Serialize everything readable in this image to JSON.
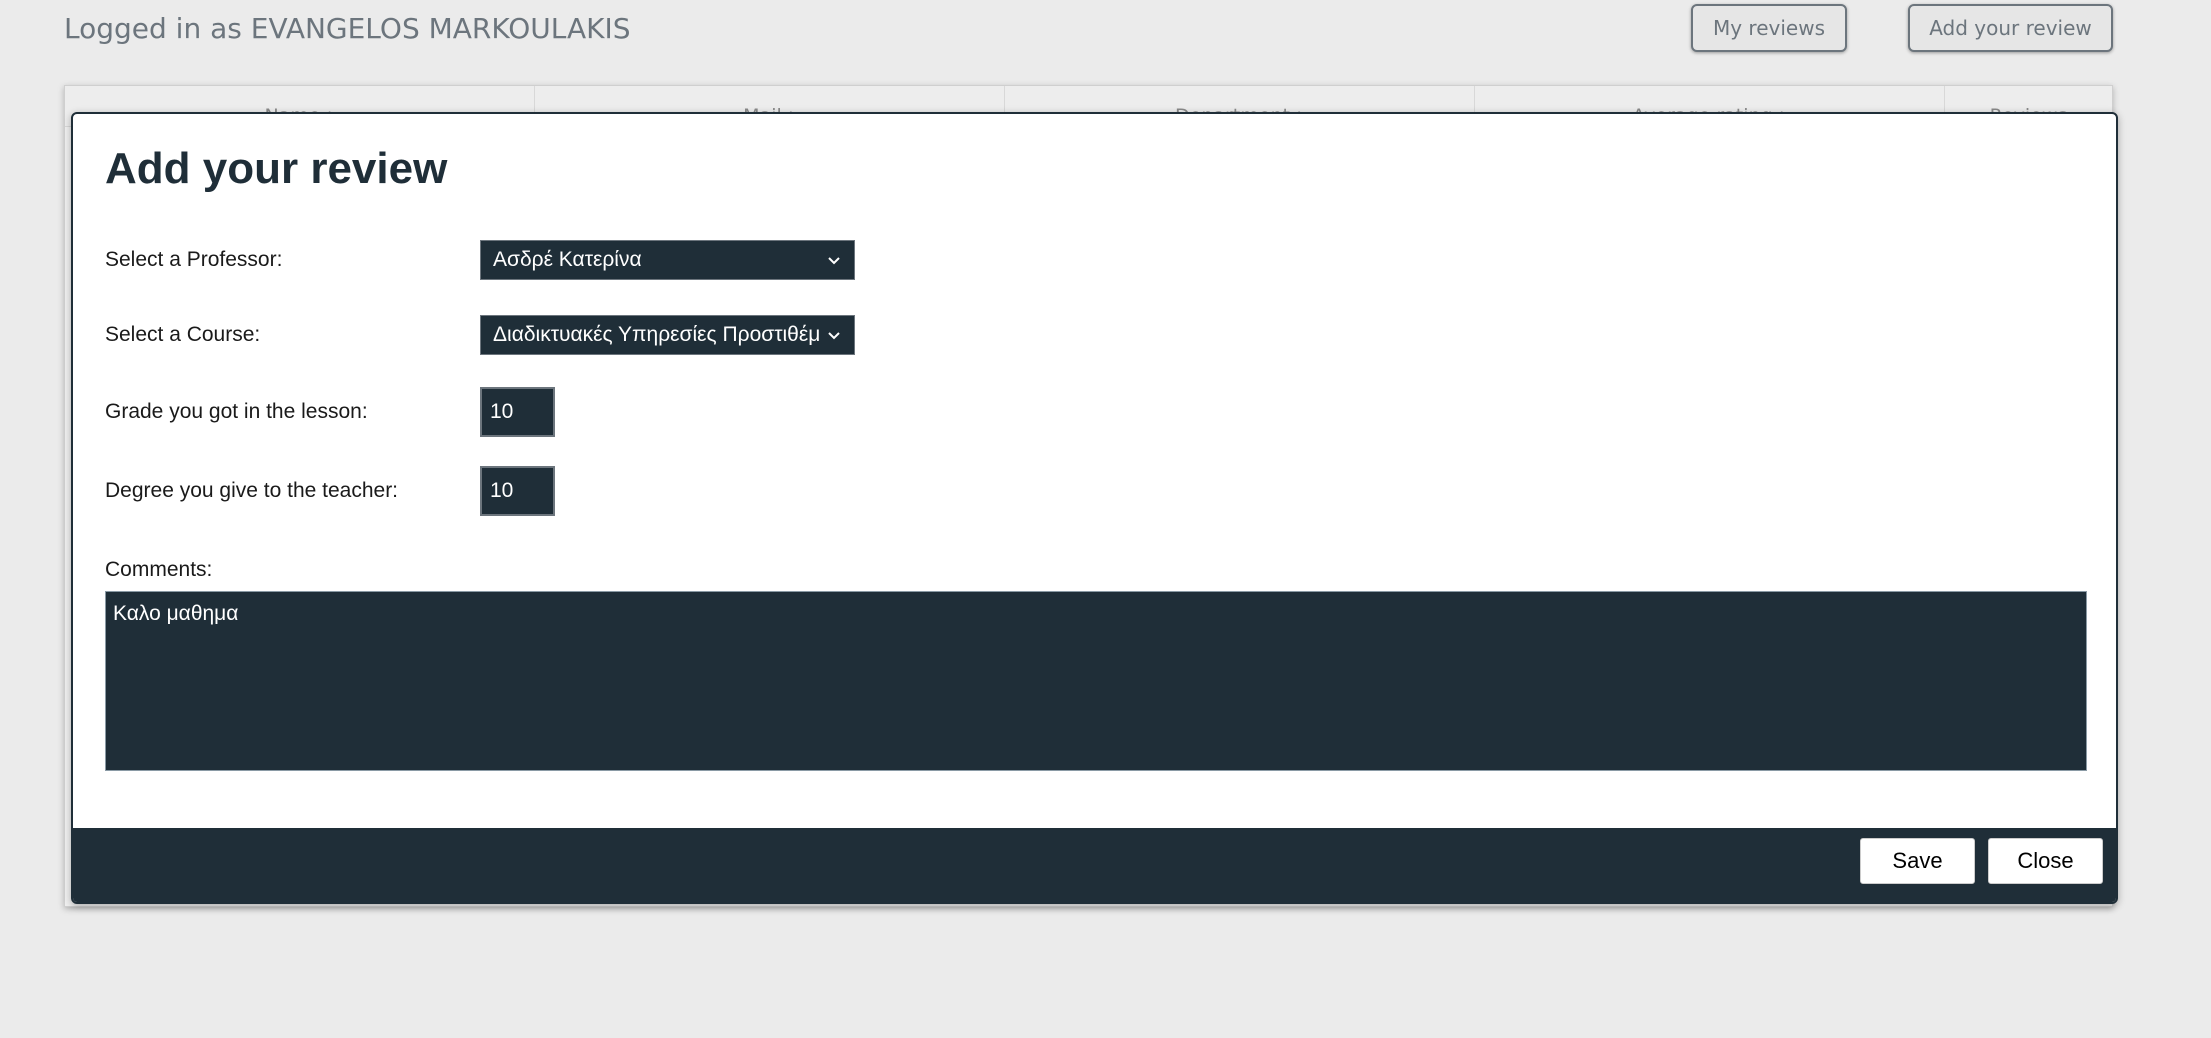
{
  "header": {
    "logged_in_text": "Logged in as EVANGELOS MARKOULAKIS",
    "my_reviews_label": "My reviews",
    "add_review_label": "Add your review"
  },
  "table": {
    "columns": [
      "Name",
      "Mail",
      "Department",
      "Average rating",
      "Reviews"
    ]
  },
  "modal": {
    "title": "Add your review",
    "professor_label": "Select a Professor:",
    "professor_value": "Ασδρέ Κατερίνα",
    "course_label": "Select a Course:",
    "course_value": "Διαδικτυακές Υπηρεσίες Προστιθέμ",
    "grade_label": "Grade you got in the lesson:",
    "grade_value": "10",
    "degree_label": "Degree you give to the teacher:",
    "degree_value": "10",
    "comments_label": "Comments:",
    "comments_value": "Καλο μαθημα",
    "save_label": "Save",
    "close_label": "Close"
  },
  "colors": {
    "dark": "#1f2e38",
    "background": "#ebebeb",
    "muted_text": "#6c757d"
  }
}
